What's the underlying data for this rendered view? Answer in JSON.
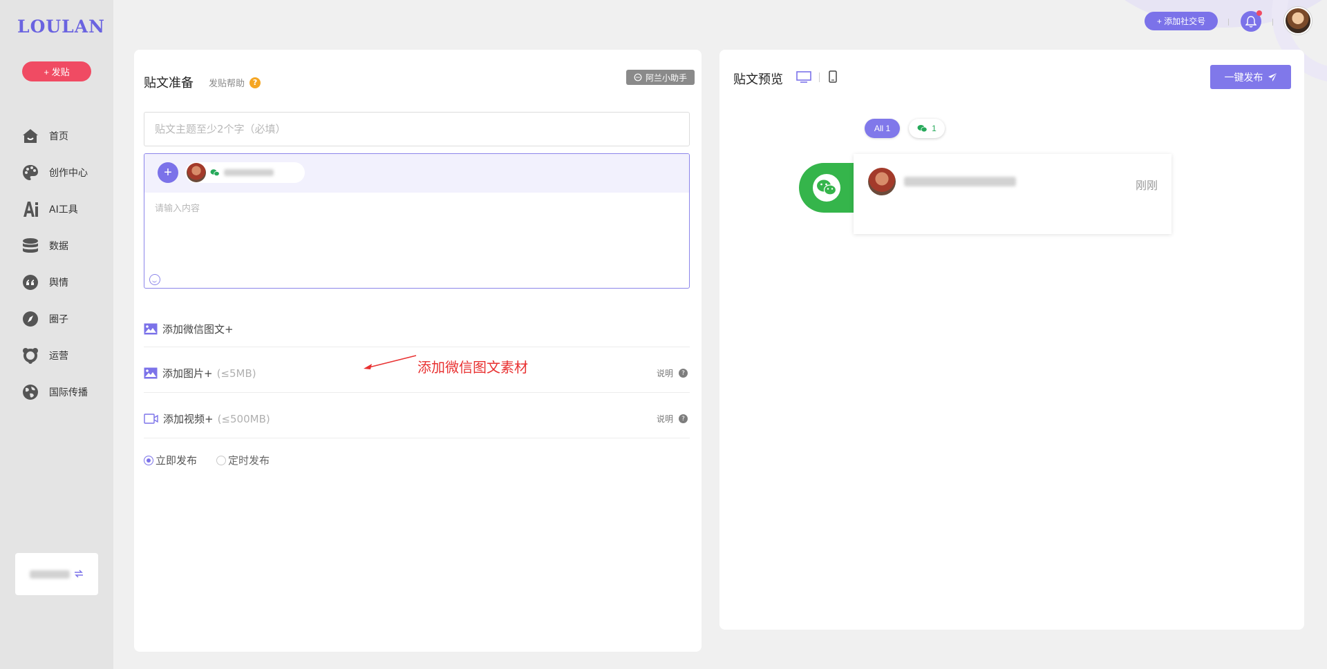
{
  "sidebar": {
    "logo": "LOULAN",
    "post_button": "+ 发贴",
    "items": [
      {
        "label": "首页",
        "icon": "home-icon"
      },
      {
        "label": "创作中心",
        "icon": "palette-icon"
      },
      {
        "label": "AI工具",
        "icon": "ai-icon"
      },
      {
        "label": "数据",
        "icon": "database-icon"
      },
      {
        "label": "舆情",
        "icon": "quote-icon"
      },
      {
        "label": "圈子",
        "icon": "compass-icon"
      },
      {
        "label": "运营",
        "icon": "operations-icon"
      },
      {
        "label": "国际传播",
        "icon": "globe-icon"
      }
    ]
  },
  "topbar": {
    "add_social": "+ 添加社交号"
  },
  "compose": {
    "title": "贴文准备",
    "help": "发贴帮助",
    "help_mark": "?",
    "assistant": "阿兰小助手",
    "topic_placeholder": "贴文主题至少2个字（必填）",
    "add_symbol": "+",
    "content_placeholder": "请输入内容",
    "add_wechat_article": "添加微信图文+",
    "add_image": "添加图片+",
    "image_limit": "(≤5MB)",
    "add_video": "添加视频+",
    "video_limit": "(≤500MB)",
    "note": "说明",
    "note_mark": "?",
    "publish_now": "立即发布",
    "schedule": "定时发布",
    "annotation": "添加微信图文素材"
  },
  "preview": {
    "title": "贴文预览",
    "publish_all": "一键发布",
    "filter_all": "All 1",
    "filter_wechat_count": "1",
    "time": "刚刚"
  },
  "colors": {
    "accent": "#7b72e9",
    "post_red": "#f04b63",
    "wechat_green": "#35b54b",
    "annotation_red": "#e83030"
  }
}
